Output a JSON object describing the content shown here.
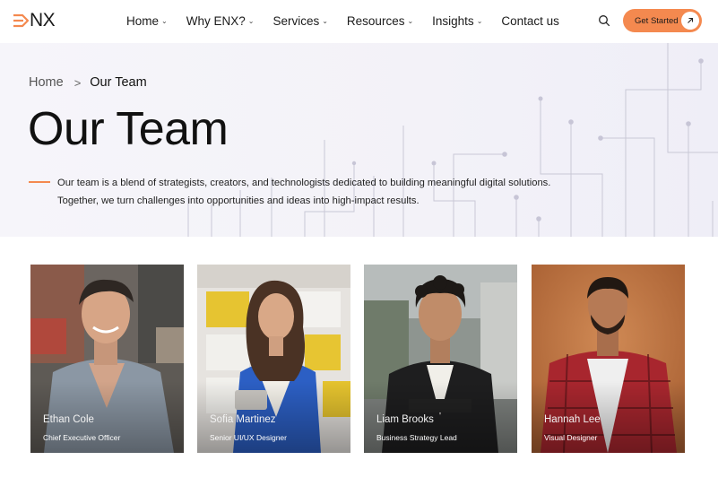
{
  "brand": {
    "logo_text": "NX",
    "accent": "#f4894f"
  },
  "nav": {
    "items": [
      {
        "label": "Home",
        "has_dropdown": true
      },
      {
        "label": "Why ENX?",
        "has_dropdown": true
      },
      {
        "label": "Services",
        "has_dropdown": true
      },
      {
        "label": "Resources",
        "has_dropdown": true
      },
      {
        "label": "Insights",
        "has_dropdown": true
      },
      {
        "label": "Contact us",
        "has_dropdown": false
      }
    ],
    "dropdown_glyph": "⌄",
    "search_icon": "search-icon",
    "cta_label": "Get Started",
    "cta_icon": "arrow-up-right-icon"
  },
  "breadcrumb": {
    "home": "Home",
    "separator": ">",
    "current": "Our Team"
  },
  "hero": {
    "title": "Our Team",
    "intro_line1": "Our team is a blend of strategists, creators, and technologists dedicated to building meaningful digital solutions.",
    "intro_line2": "Together, we turn challenges into opportunities and ideas into high-impact results."
  },
  "team": [
    {
      "name": "Ethan Cole",
      "role": "Chief Executive Officer"
    },
    {
      "name": "Sofia Martinez",
      "role": "Senior UI/UX Designer"
    },
    {
      "name": "Liam Brooks",
      "role": "Business Strategy Lead"
    },
    {
      "name": "Hannah Lee",
      "role": "Visual Designer"
    }
  ]
}
